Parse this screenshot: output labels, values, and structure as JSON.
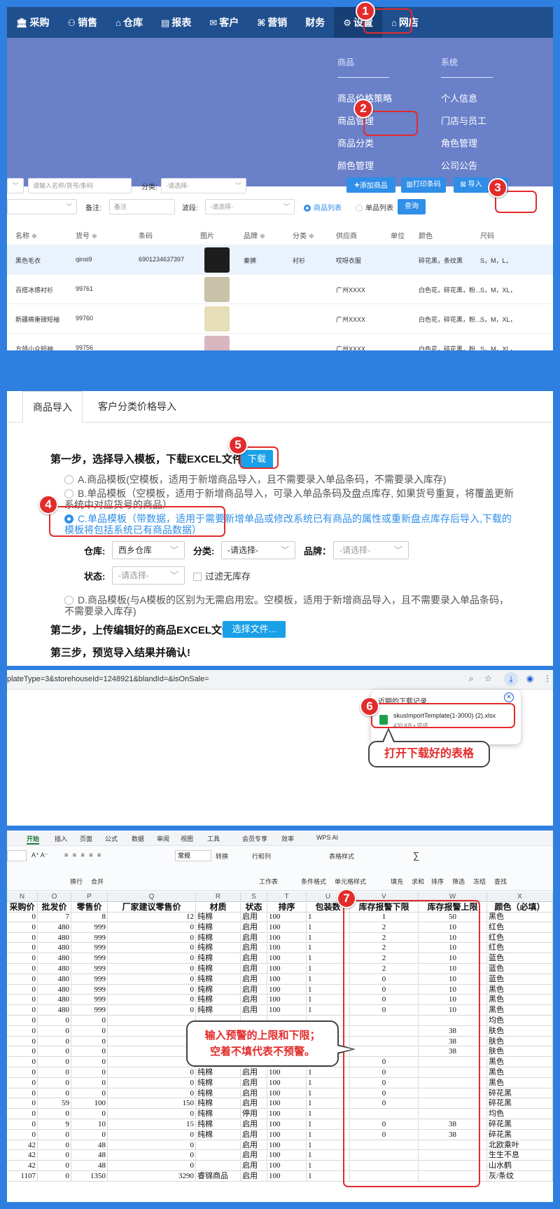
{
  "colors": {
    "accent": "#2f8ee8",
    "annotation_red": "#e32b2b",
    "nav": "#1f4f8f",
    "menu": "#6a80c9"
  },
  "nav": {
    "items": [
      {
        "icon": "bank-icon",
        "label": "采购"
      },
      {
        "icon": "people-icon",
        "label": "销售"
      },
      {
        "icon": "warehouse-icon",
        "label": "仓库"
      },
      {
        "icon": "report-icon",
        "label": "报表"
      },
      {
        "icon": "mail-icon",
        "label": "客户"
      },
      {
        "icon": "tag-icon",
        "label": "营销"
      },
      {
        "icon": "",
        "label": "财务"
      },
      {
        "icon": "settings-icon",
        "label": "设置"
      },
      {
        "icon": "home-icon",
        "label": "网店"
      }
    ],
    "menu": {
      "goods_header": "商品",
      "system_header": "系统",
      "goods": [
        "商品价格策略",
        "商品管理",
        "商品分类",
        "颜色管理"
      ],
      "system": [
        "个人信息",
        "门店与员工",
        "角色管理",
        "公司公告"
      ]
    }
  },
  "badges": [
    "1",
    "2",
    "3",
    "4",
    "5",
    "6",
    "7"
  ],
  "toolbar": {
    "search_placeholder": "请输入名称/货号/条码",
    "category_label": "分类:",
    "category_value": "-请选择-",
    "add_button": "添加商品",
    "print_button": "打印条码",
    "import_button": "导入",
    "note_label": "备注:",
    "note_placeholder": "备注",
    "band_label": "波段:",
    "band_value": "-请选择-",
    "view_goods": "商品列表",
    "view_sku": "单品列表",
    "query_button": "查询"
  },
  "table": {
    "headers": [
      "名称 ≑",
      "货号 ≑",
      "条码",
      "图片",
      "品牌 ≑",
      "分类 ≑",
      "供应商",
      "单位",
      "颜色",
      "尺码"
    ],
    "rows": [
      {
        "name": "黑色毛衣",
        "code": "qinsi9",
        "barcode": "6901234637397",
        "brand": "秦狮",
        "category": "衬衫",
        "supplier": "哎呀衣服",
        "unit": "",
        "color": "碎花黑，条纹黑",
        "size": "S，M，L，"
      },
      {
        "name": "百搭冰感衬衫",
        "code": "99761",
        "barcode": "",
        "brand": "",
        "category": "",
        "supplier": "广州XXXX",
        "unit": "",
        "color": "白色花，碎花黑，粉...",
        "size": "S，M，XL，"
      },
      {
        "name": "新疆棉重磅短袖",
        "code": "99760",
        "barcode": "",
        "brand": "",
        "category": "",
        "supplier": "广州XXXX",
        "unit": "",
        "color": "白色花，碎花黑，粉...",
        "size": "S，M，XL，"
      },
      {
        "name": "方领小众短袖",
        "code": "99756",
        "barcode": "",
        "brand": "",
        "category": "",
        "supplier": "广州XXXX",
        "unit": "",
        "color": "白色花，碎花黑，粉...",
        "size": "S，M，XL，"
      }
    ]
  },
  "import": {
    "tabs": [
      "商品导入",
      "客户分类价格导入"
    ],
    "step1": "第一步，选择导入模板，下载EXCEL文件",
    "download_button": "下载",
    "option_a": "A.商品模板(空模板，适用于新增商品导入，且不需要录入单品条码，不需要录入库存)",
    "option_b_1": "B.单品模板（空模板，适用于新增商品导入，可录入单品条码及盘点库存, 如果货号重复，将覆盖更新",
    "option_b_2": "系统中对应货号的商品）",
    "option_c_1": "C.单品模板（带数据，适用于需要新增单品或修改系统已有商品的属性或重新盘点库存后导入,下载的",
    "option_c_2": "模板将包括系统已有商品数据）",
    "warehouse_label": "仓库:",
    "warehouse_value": "西乡仓库",
    "category_label": "分类:",
    "category_value": "-请选择-",
    "brand_label": "品牌：",
    "brand_value": "-请选择-",
    "status_label": "状态:",
    "status_value": "-请选择-",
    "filter_label": "过滤无库存",
    "option_d_1": "D.商品模板(与A模板的区别为无需启用宏。空模板，适用于新增商品导入，且不需要录入单品条码，",
    "option_d_2": "不需要录入库存)",
    "step2": "第二步，上传编辑好的商品EXCEL文件",
    "choose_file": "选择文件...",
    "step3": "第三步，预览导入结果并确认!"
  },
  "browser": {
    "url": "plateType=3&storehouseId=1248921&blandId=&isOnSale=",
    "downloads_title": "近期的下载记录",
    "file_name": "skusImportTemplate(1-3000) (2).xlsx",
    "file_meta": "430 KB • 完成",
    "callout": "打开下载好的表格"
  },
  "sheet": {
    "ribbon_tabs": [
      "开始",
      "插入",
      "页面",
      "公式",
      "数据",
      "审阅",
      "视图",
      "工具",
      "会员专享",
      "效率",
      "WPS AI"
    ],
    "ribbon_row1": [
      "A⁺ A⁻",
      "常规",
      "转换",
      "行和列",
      "表格样式",
      "∑",
      "排序",
      "筛选",
      "冻结",
      "查找"
    ],
    "ribbon_row2": [
      "换行",
      "合并",
      "工作表",
      "条件格式",
      "单元格样式",
      "填充",
      "求和",
      "排序",
      "筛选",
      "冻结",
      "查找"
    ],
    "columns": [
      "N",
      "O",
      "P",
      "Q",
      "R",
      "S",
      "T",
      "U",
      "V",
      "W",
      "X"
    ],
    "headers": [
      "采购价",
      "批发价",
      "零售价",
      "厂家建议零售价",
      "材质",
      "状态",
      "排序",
      "包装数",
      "库存报警下限",
      "库存报警上限",
      "颜色（必填）"
    ],
    "rows": [
      [
        "0",
        "7",
        "8",
        "12",
        "纯棉",
        "启用",
        "100",
        "1",
        "1",
        "50",
        "黑色"
      ],
      [
        "0",
        "480",
        "999",
        "0",
        "纯棉",
        "启用",
        "100",
        "1",
        "2",
        "10",
        "红色"
      ],
      [
        "0",
        "480",
        "999",
        "0",
        "纯棉",
        "启用",
        "100",
        "1",
        "2",
        "10",
        "红色"
      ],
      [
        "0",
        "480",
        "999",
        "0",
        "纯棉",
        "启用",
        "100",
        "1",
        "2",
        "10",
        "红色"
      ],
      [
        "0",
        "480",
        "999",
        "0",
        "纯棉",
        "启用",
        "100",
        "1",
        "2",
        "10",
        "蓝色"
      ],
      [
        "0",
        "480",
        "999",
        "0",
        "纯棉",
        "启用",
        "100",
        "1",
        "2",
        "10",
        "蓝色"
      ],
      [
        "0",
        "480",
        "999",
        "0",
        "纯棉",
        "启用",
        "100",
        "1",
        "0",
        "10",
        "蓝色"
      ],
      [
        "0",
        "480",
        "999",
        "0",
        "纯棉",
        "启用",
        "100",
        "1",
        "0",
        "10",
        "黑色"
      ],
      [
        "0",
        "480",
        "999",
        "0",
        "纯棉",
        "启用",
        "100",
        "1",
        "0",
        "10",
        "黑色"
      ],
      [
        "0",
        "480",
        "999",
        "0",
        "纯棉",
        "启用",
        "100",
        "1",
        "0",
        "10",
        "黑色"
      ],
      [
        "0",
        "0",
        "0",
        "",
        "",
        "",
        "",
        "",
        "",
        "",
        "均色"
      ],
      [
        "0",
        "0",
        "0",
        "",
        "",
        "",
        "",
        "",
        "",
        "38",
        "肤色"
      ],
      [
        "0",
        "0",
        "0",
        "",
        "",
        "",
        "",
        "",
        "",
        "38",
        "肤色"
      ],
      [
        "0",
        "0",
        "0",
        "0",
        "纯棉",
        "启用",
        "100",
        "1",
        "",
        "38",
        "肤色"
      ],
      [
        "0",
        "0",
        "0",
        "0",
        "纯棉",
        "启用",
        "100",
        "1",
        "0",
        "",
        "黑色"
      ],
      [
        "0",
        "0",
        "0",
        "0",
        "纯棉",
        "启用",
        "100",
        "1",
        "0",
        "",
        "黑色"
      ],
      [
        "0",
        "0",
        "0",
        "0",
        "纯棉",
        "启用",
        "100",
        "1",
        "0",
        "",
        "黑色"
      ],
      [
        "0",
        "0",
        "0",
        "0",
        "纯棉",
        "启用",
        "100",
        "1",
        "0",
        "",
        "碎花黑"
      ],
      [
        "0",
        "59",
        "100",
        "150",
        "纯棉",
        "启用",
        "100",
        "1",
        "0",
        "",
        "碎花黑"
      ],
      [
        "0",
        "0",
        "0",
        "0",
        "纯棉",
        "停用",
        "100",
        "1",
        "",
        "",
        "均色"
      ],
      [
        "0",
        "9",
        "10",
        "15",
        "纯棉",
        "启用",
        "100",
        "1",
        "0",
        "38",
        "碎花黑"
      ],
      [
        "0",
        "0",
        "0",
        "0",
        "纯棉",
        "启用",
        "100",
        "1",
        "0",
        "38",
        "碎花黑"
      ],
      [
        "42",
        "0",
        "48",
        "0",
        "",
        "启用",
        "100",
        "1",
        "",
        "",
        "北欧乘叶"
      ],
      [
        "42",
        "0",
        "48",
        "0",
        "",
        "启用",
        "100",
        "1",
        "",
        "",
        "生生不息"
      ],
      [
        "42",
        "0",
        "48",
        "0",
        "",
        "启用",
        "100",
        "1",
        "",
        "",
        "山水鹤"
      ],
      [
        "1107",
        "0",
        "1350",
        "3290",
        "睿锦商品",
        "启用",
        "100",
        "1",
        "",
        "",
        "灰/条纹"
      ]
    ],
    "callout_line1": "输入预警的上限和下限；",
    "callout_line2": "空着不填代表不预警。"
  }
}
